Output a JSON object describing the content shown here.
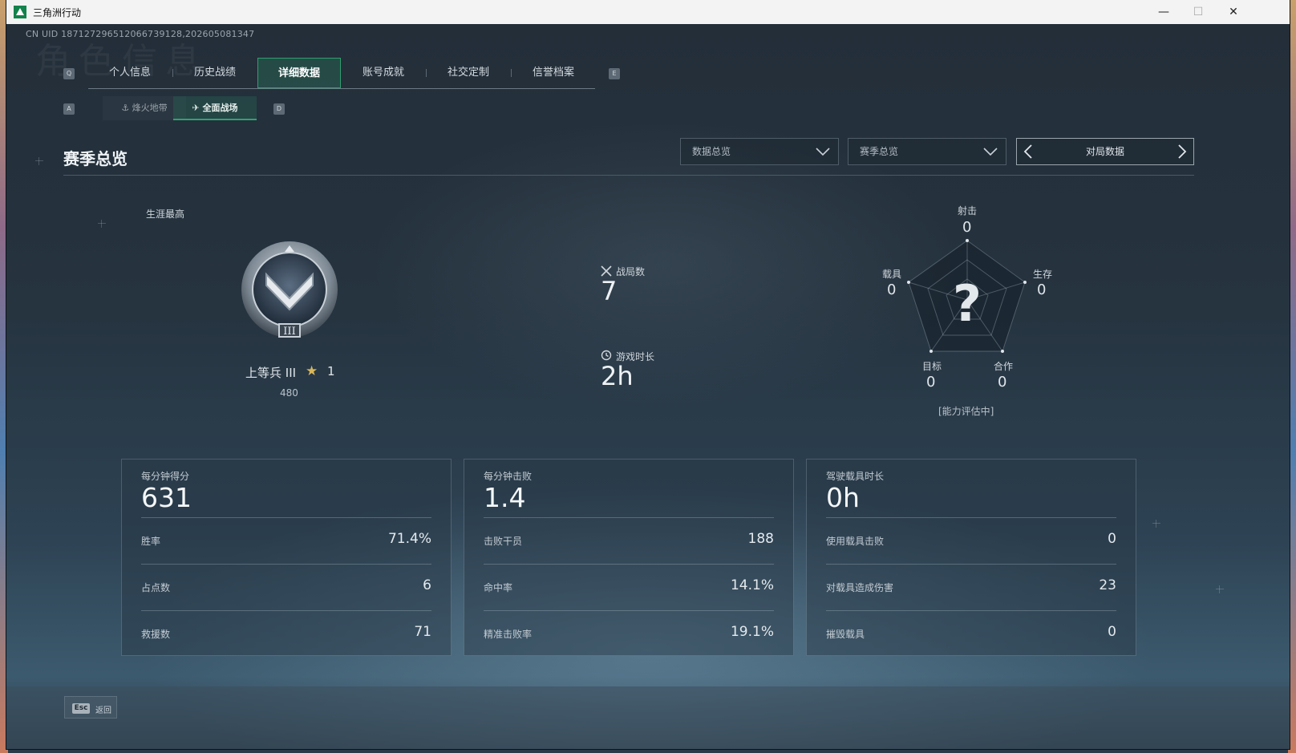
{
  "window": {
    "title": "三角洲行动",
    "minimize": "—",
    "maximize": "☐",
    "close": "✕"
  },
  "uid": "CN UID 18712729651206673912​8,202605081347",
  "bg_word": "角色信息",
  "tabs": {
    "left_key": "Q",
    "right_key": "E",
    "items": [
      {
        "label": "个人信息"
      },
      {
        "label": "历史战绩"
      },
      {
        "label": "详细数据",
        "active": true
      },
      {
        "label": "账号成就"
      },
      {
        "label": "社交定制"
      },
      {
        "label": "信誉档案"
      }
    ]
  },
  "subtabs": {
    "left_key": "A",
    "right_key": "D",
    "items": [
      {
        "label": "烽火地带"
      },
      {
        "label": "全面战场",
        "active": true
      }
    ]
  },
  "section": {
    "title": "赛季总览"
  },
  "filters": {
    "data_select": "数据总览",
    "season_select": "赛季总览",
    "pager_label": "对局数据"
  },
  "career": {
    "label": "生涯最高",
    "rank_name": "上等兵 III",
    "stars": "1",
    "points": "480",
    "emblem_numeral": "III"
  },
  "matches": {
    "label": "战局数",
    "value": "7"
  },
  "playtime": {
    "label": "游戏时长",
    "value": "2h"
  },
  "radar": {
    "status": "[能力评估中]",
    "center_mark": "?",
    "axes": [
      {
        "label": "射击",
        "value": "0"
      },
      {
        "label": "生存",
        "value": "0"
      },
      {
        "label": "合作",
        "value": "0"
      },
      {
        "label": "目标",
        "value": "0"
      },
      {
        "label": "载具",
        "value": "0"
      }
    ]
  },
  "cards": [
    {
      "head_label": "每分钟得分",
      "head_value": "631",
      "rows": [
        {
          "label": "胜率",
          "value": "71.4%"
        },
        {
          "label": "占点数",
          "value": "6"
        },
        {
          "label": "救援数",
          "value": "71"
        }
      ]
    },
    {
      "head_label": "每分钟击败",
      "head_value": "1.4",
      "rows": [
        {
          "label": "击败干员",
          "value": "188"
        },
        {
          "label": "命中率",
          "value": "14.1%"
        },
        {
          "label": "精准击败率",
          "value": "19.1%"
        }
      ]
    },
    {
      "head_label": "驾驶载具时长",
      "head_value": "0h",
      "rows": [
        {
          "label": "使用载具击败",
          "value": "0"
        },
        {
          "label": "对载具造成伤害",
          "value": "23"
        },
        {
          "label": "摧毁载具",
          "value": "0"
        }
      ]
    }
  ],
  "footer": {
    "esc_key": "Esc",
    "back_label": "返回"
  },
  "colors": {
    "accent": "#2f9f6e",
    "star": "#d8b75a"
  }
}
